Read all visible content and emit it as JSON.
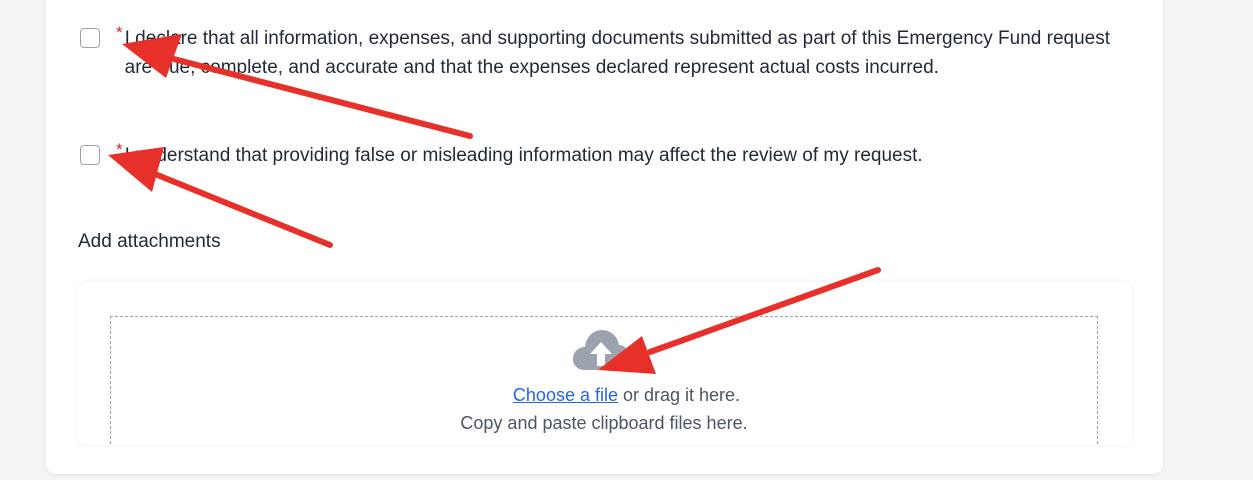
{
  "declarations": [
    {
      "required_mark": "*",
      "text": "I declare that all information, expenses, and supporting documents submitted as part of this Emergency Fund request are true, complete, and accurate and that the expenses declared represent actual costs incurred."
    },
    {
      "required_mark": "*",
      "text": "I understand that providing false or misleading information may affect the review of my request."
    }
  ],
  "attachments": {
    "label": "Add attachments",
    "upload_icon": "cloud-upload-icon",
    "choose_link": "Choose a file",
    "drag_text": " or drag it here.",
    "paste_text": "Copy and paste clipboard files here."
  },
  "colors": {
    "required": "#dc2626",
    "link": "#2563eb",
    "annotation_arrow": "#e8302a"
  }
}
